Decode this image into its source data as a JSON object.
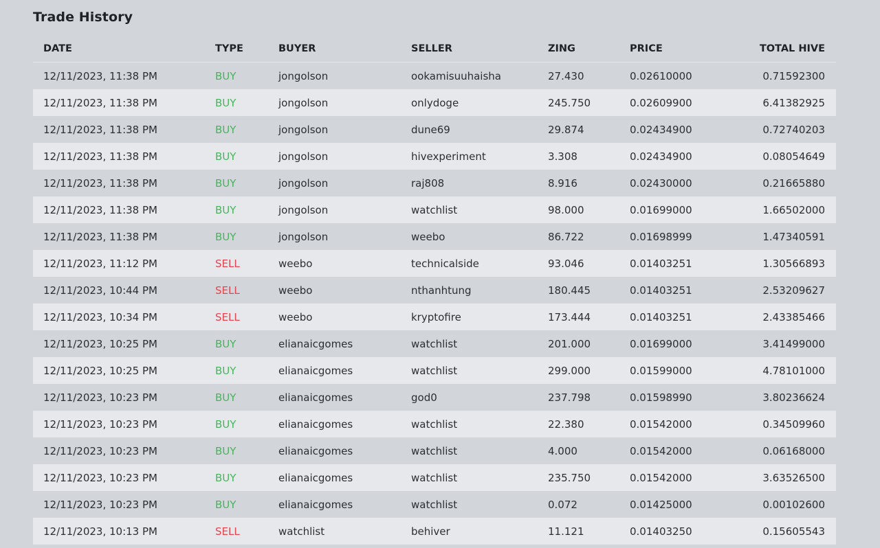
{
  "title": "Trade History",
  "colors": {
    "buy": "#46b55a",
    "sell": "#e04550"
  },
  "columns": [
    "DATE",
    "TYPE",
    "BUYER",
    "SELLER",
    "ZING",
    "PRICE",
    "TOTAL HIVE"
  ],
  "rows": [
    {
      "date": "12/11/2023, 11:38 PM",
      "type": "BUY",
      "buyer": "jongolson",
      "seller": "ookamisuuhaisha",
      "zing": "27.430",
      "price": "0.02610000",
      "total": "0.71592300"
    },
    {
      "date": "12/11/2023, 11:38 PM",
      "type": "BUY",
      "buyer": "jongolson",
      "seller": "onlydoge",
      "zing": "245.750",
      "price": "0.02609900",
      "total": "6.41382925"
    },
    {
      "date": "12/11/2023, 11:38 PM",
      "type": "BUY",
      "buyer": "jongolson",
      "seller": "dune69",
      "zing": "29.874",
      "price": "0.02434900",
      "total": "0.72740203"
    },
    {
      "date": "12/11/2023, 11:38 PM",
      "type": "BUY",
      "buyer": "jongolson",
      "seller": "hivexperiment",
      "zing": "3.308",
      "price": "0.02434900",
      "total": "0.08054649"
    },
    {
      "date": "12/11/2023, 11:38 PM",
      "type": "BUY",
      "buyer": "jongolson",
      "seller": "raj808",
      "zing": "8.916",
      "price": "0.02430000",
      "total": "0.21665880"
    },
    {
      "date": "12/11/2023, 11:38 PM",
      "type": "BUY",
      "buyer": "jongolson",
      "seller": "watchlist",
      "zing": "98.000",
      "price": "0.01699000",
      "total": "1.66502000"
    },
    {
      "date": "12/11/2023, 11:38 PM",
      "type": "BUY",
      "buyer": "jongolson",
      "seller": "weebo",
      "zing": "86.722",
      "price": "0.01698999",
      "total": "1.47340591"
    },
    {
      "date": "12/11/2023, 11:12 PM",
      "type": "SELL",
      "buyer": "weebo",
      "seller": "technicalside",
      "zing": "93.046",
      "price": "0.01403251",
      "total": "1.30566893"
    },
    {
      "date": "12/11/2023, 10:44 PM",
      "type": "SELL",
      "buyer": "weebo",
      "seller": "nthanhtung",
      "zing": "180.445",
      "price": "0.01403251",
      "total": "2.53209627"
    },
    {
      "date": "12/11/2023, 10:34 PM",
      "type": "SELL",
      "buyer": "weebo",
      "seller": "kryptofire",
      "zing": "173.444",
      "price": "0.01403251",
      "total": "2.43385466"
    },
    {
      "date": "12/11/2023, 10:25 PM",
      "type": "BUY",
      "buyer": "elianaicgomes",
      "seller": "watchlist",
      "zing": "201.000",
      "price": "0.01699000",
      "total": "3.41499000"
    },
    {
      "date": "12/11/2023, 10:25 PM",
      "type": "BUY",
      "buyer": "elianaicgomes",
      "seller": "watchlist",
      "zing": "299.000",
      "price": "0.01599000",
      "total": "4.78101000"
    },
    {
      "date": "12/11/2023, 10:23 PM",
      "type": "BUY",
      "buyer": "elianaicgomes",
      "seller": "god0",
      "zing": "237.798",
      "price": "0.01598990",
      "total": "3.80236624"
    },
    {
      "date": "12/11/2023, 10:23 PM",
      "type": "BUY",
      "buyer": "elianaicgomes",
      "seller": "watchlist",
      "zing": "22.380",
      "price": "0.01542000",
      "total": "0.34509960"
    },
    {
      "date": "12/11/2023, 10:23 PM",
      "type": "BUY",
      "buyer": "elianaicgomes",
      "seller": "watchlist",
      "zing": "4.000",
      "price": "0.01542000",
      "total": "0.06168000"
    },
    {
      "date": "12/11/2023, 10:23 PM",
      "type": "BUY",
      "buyer": "elianaicgomes",
      "seller": "watchlist",
      "zing": "235.750",
      "price": "0.01542000",
      "total": "3.63526500"
    },
    {
      "date": "12/11/2023, 10:23 PM",
      "type": "BUY",
      "buyer": "elianaicgomes",
      "seller": "watchlist",
      "zing": "0.072",
      "price": "0.01425000",
      "total": "0.00102600"
    },
    {
      "date": "12/11/2023, 10:13 PM",
      "type": "SELL",
      "buyer": "watchlist",
      "seller": "behiver",
      "zing": "11.121",
      "price": "0.01403250",
      "total": "0.15605543"
    }
  ]
}
